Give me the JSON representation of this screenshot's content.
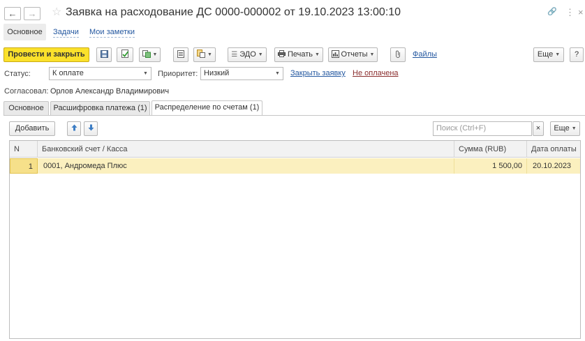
{
  "window": {
    "title": "Заявка на расходование ДС 0000-000002 от 19.10.2023 13:00:10",
    "back_glyph": "←",
    "forward_glyph": "→",
    "star_glyph": "☆",
    "link_glyph": "🔗",
    "more_glyph": "⋮",
    "close_glyph": "×"
  },
  "nav": {
    "items": [
      "Основное",
      "Задачи",
      "Мои заметки"
    ]
  },
  "toolbar": {
    "post_close": "Провести и закрыть",
    "edo": "ЭДО",
    "print": "Печать",
    "reports": "Отчеты",
    "files": "Файлы",
    "more": "Еще",
    "help": "?"
  },
  "form": {
    "status_label": "Статус:",
    "status_value": "К оплате",
    "priority_label": "Приоритет:",
    "priority_value": "Низкий",
    "close_request_link": "Закрыть заявку",
    "not_paid_link": "Не оплачена",
    "approved_label": "Согласовал:",
    "approved_value": "Орлов Александр Владимирович"
  },
  "tabs": [
    "Основное",
    "Расшифровка платежа (1)",
    "Распределение по счетам (1)"
  ],
  "table_toolbar": {
    "add": "Добавить",
    "search_placeholder": "Поиск (Ctrl+F)",
    "clear": "×",
    "more": "Еще"
  },
  "table": {
    "columns": [
      "N",
      "Банковский счет / Касса",
      "Сумма (RUB)",
      "Дата оплаты"
    ],
    "rows": [
      {
        "n": "1",
        "account": "0001, Андромеда Плюс",
        "sum": "1 500,00",
        "date": "20.10.2023"
      }
    ]
  }
}
